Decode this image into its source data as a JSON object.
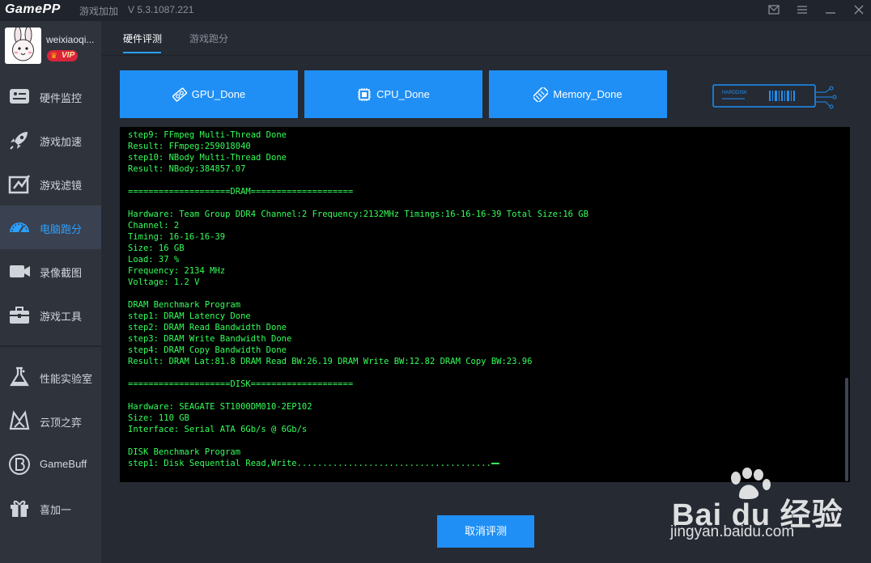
{
  "titlebar": {
    "logo": "GamePP",
    "app_name": "游戏加加",
    "version": "V 5.3.1087.221",
    "icons": [
      "mail-icon",
      "menu-icon",
      "minimize-icon",
      "close-icon"
    ]
  },
  "user": {
    "name": "weixiaoqi...",
    "badge": "VIP"
  },
  "sidebar": {
    "items": [
      {
        "label": "硬件监控",
        "icon": "hardware-monitor-icon"
      },
      {
        "label": "游戏加速",
        "icon": "rocket-icon"
      },
      {
        "label": "游戏滤镜",
        "icon": "filter-icon"
      },
      {
        "label": "电脑跑分",
        "icon": "speedometer-icon"
      },
      {
        "label": "录像截图",
        "icon": "camera-icon"
      },
      {
        "label": "游戏工具",
        "icon": "toolbox-icon"
      },
      {
        "label": "性能实验室",
        "icon": "flask-icon"
      },
      {
        "label": "云顶之弈",
        "icon": "tft-icon"
      },
      {
        "label": "GameBuff",
        "icon": "gamebuff-icon"
      },
      {
        "label": "喜加一",
        "icon": "gift-icon"
      }
    ],
    "active_index": 3
  },
  "tabs": [
    {
      "label": "硬件评测"
    },
    {
      "label": "游戏跑分"
    }
  ],
  "buttons": {
    "gpu": "GPU_Done",
    "cpu": "CPU_Done",
    "memory": "Memory_Done",
    "disk_graphic_label": "HARDDISK",
    "cancel": "取消评测"
  },
  "console": {
    "lines": [
      "step9: FFmpeg Multi-Thread Done",
      "Result: FFmpeg:259018040",
      "step10: NBody Multi-Thread Done",
      "Result: NBody:384857.07",
      "",
      "====================DRAM====================",
      "",
      "Hardware: Team Group DDR4 Channel:2 Frequency:2132MHz Timings:16-16-16-39 Total Size:16 GB",
      "Channel: 2",
      "Timing: 16-16-16-39",
      "Size: 16 GB",
      "Load: 37 %",
      "Frequency: 2134 MHz",
      "Voltage: 1.2 V",
      "",
      "DRAM Benchmark Program",
      "step1: DRAM Latency Done",
      "step2: DRAM Read Bandwidth Done",
      "step3: DRAM Write Bandwidth Done",
      "step4: DRAM Copy Bandwidth Done",
      "Result: DRAM Lat:81.8 DRAM Read BW:26.19 DRAM Write BW:12.82 DRAM Copy BW:23.96",
      "",
      "====================DISK====================",
      "",
      "Hardware: SEAGATE ST1000DM010-2EP102",
      "Size: 110 GB",
      "Interface: Serial ATA 6Gb/s @ 6Gb/s",
      "",
      "DISK Benchmark Program",
      "step1: Disk Sequential Read,Write......................................"
    ],
    "text_color": "#34ff5a"
  },
  "watermark": {
    "main": "Bai du 经验",
    "url": "jingyan.baidu.com"
  },
  "colors": {
    "accent": "#1f8ff5",
    "active_nav_text": "#2ba0ff",
    "vip_badge": "#d9243a"
  }
}
